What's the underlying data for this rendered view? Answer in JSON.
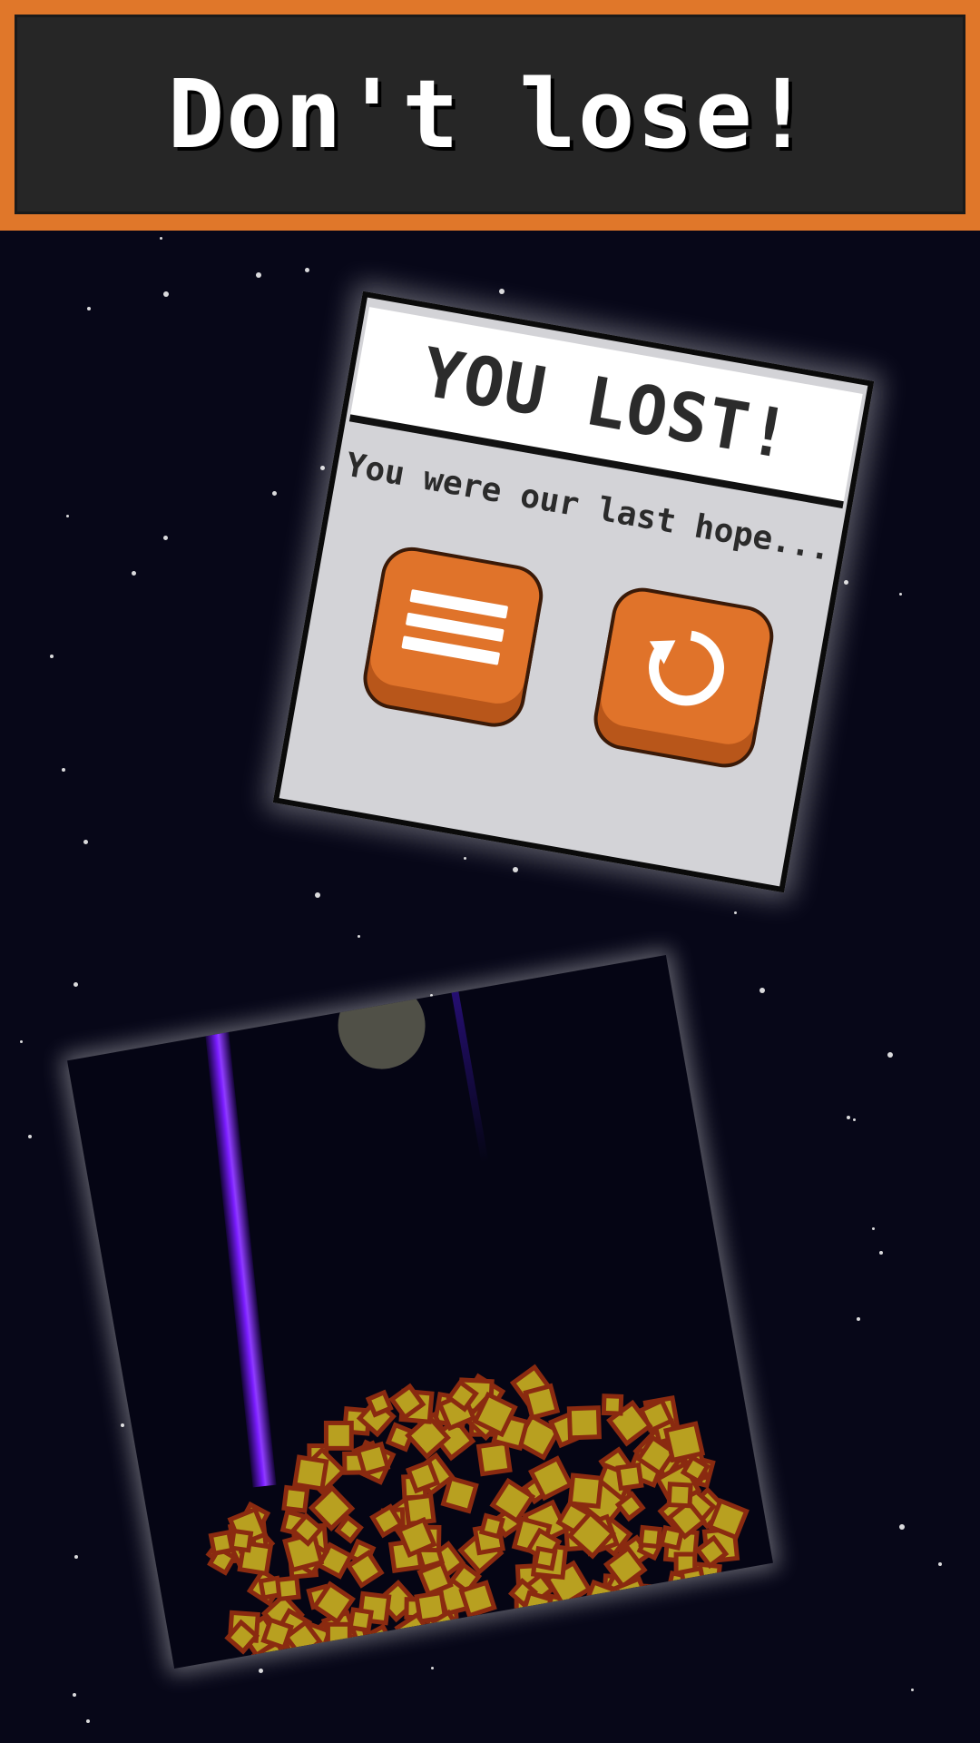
{
  "banner": {
    "title": "Don't lose!"
  },
  "dialog": {
    "title": "YOU LOST!",
    "subtitle": "You were our last hope...",
    "menu_button_icon": "menu-icon",
    "retry_button_icon": "retry-icon"
  },
  "colors": {
    "accent": "#e0772a",
    "banner_bg": "#262626",
    "space_bg": "#070718",
    "beam": "#7a1cff",
    "rubble_fill": "#b8a020",
    "rubble_edge": "#8a2a10"
  }
}
